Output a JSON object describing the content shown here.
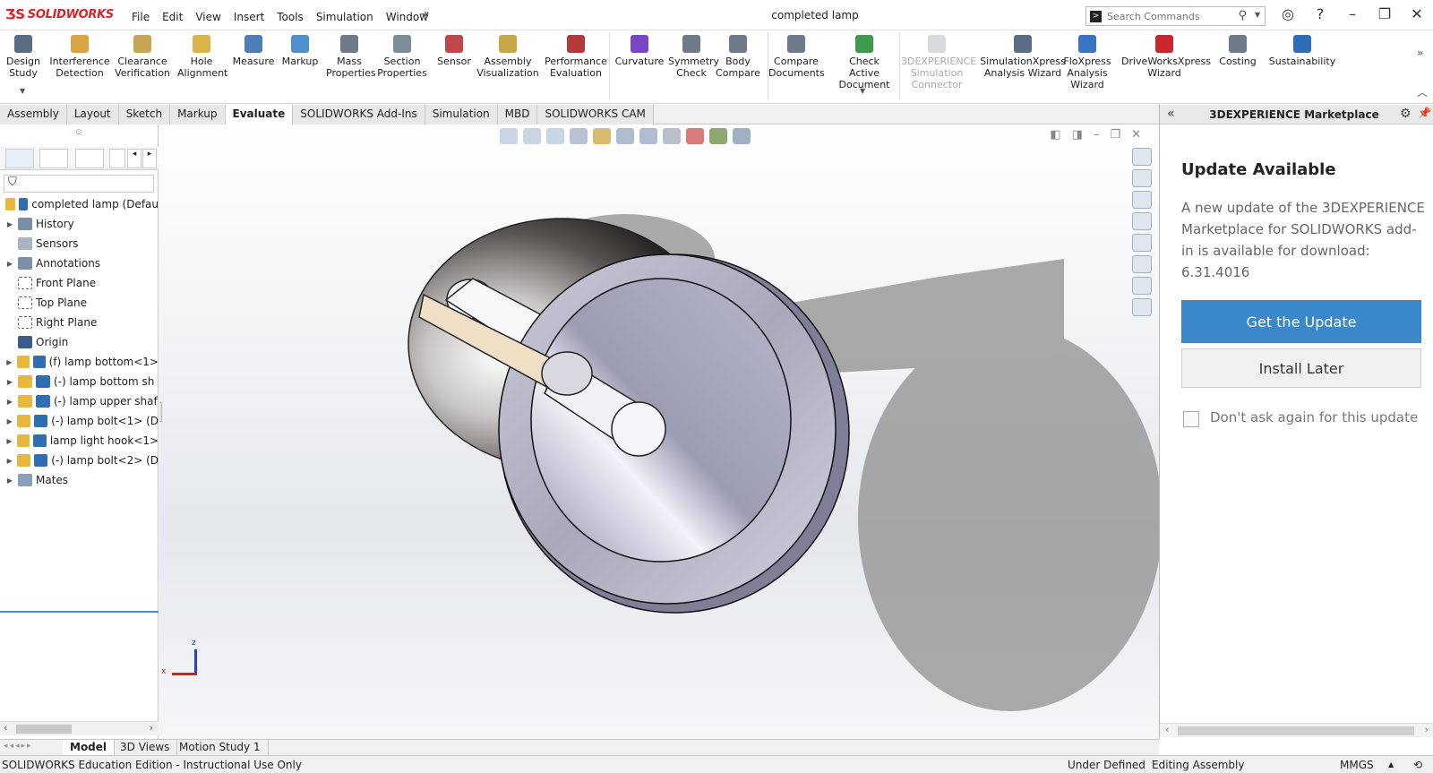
{
  "app": {
    "logo_text": "SOLIDWORKS",
    "document_title": "completed lamp",
    "menu": [
      "File",
      "Edit",
      "View",
      "Insert",
      "Tools",
      "Simulation",
      "Window"
    ],
    "search_placeholder": "Search Commands"
  },
  "ribbon": {
    "buttons": [
      {
        "label": "Design\nStudy",
        "icon": "design-study-icon",
        "color": "#5a6d86"
      },
      {
        "label": "Interference\nDetection",
        "icon": "interference-icon",
        "color": "#d9a441"
      },
      {
        "label": "Clearance\nVerification",
        "icon": "clearance-icon",
        "color": "#c7a653"
      },
      {
        "label": "Hole\nAlignment",
        "icon": "hole-alignment-icon",
        "color": "#d8b44a"
      },
      {
        "label": "Measure",
        "icon": "measure-icon",
        "color": "#4c7fb8"
      },
      {
        "label": "Markup",
        "icon": "markup-icon",
        "color": "#4f8fcf"
      },
      {
        "label": "Mass\nProperties",
        "icon": "mass-properties-icon",
        "color": "#6f7b8a"
      },
      {
        "label": "Section\nProperties",
        "icon": "section-properties-icon",
        "color": "#7e8b99"
      },
      {
        "label": "Sensor",
        "icon": "sensor-icon",
        "color": "#c04848"
      },
      {
        "label": "Assembly\nVisualization",
        "icon": "assembly-visualization-icon",
        "color": "#c9a64a"
      },
      {
        "label": "Performance\nEvaluation",
        "icon": "performance-icon",
        "color": "#b33a3a"
      },
      {
        "label": "Curvature",
        "icon": "curvature-icon",
        "color": "#7a46c4"
      },
      {
        "label": "Symmetry\nCheck",
        "icon": "symmetry-icon",
        "color": "#6f7b8a"
      },
      {
        "label": "Body\nCompare",
        "icon": "body-compare-icon",
        "color": "#6f7b8a"
      },
      {
        "label": "Compare\nDocuments",
        "icon": "compare-documents-icon",
        "color": "#6f7b8a"
      },
      {
        "label": "Check Active\nDocument",
        "icon": "check-active-icon",
        "color": "#3f9a4a"
      },
      {
        "label": "3DEXPERIENCE\nSimulation\nConnector",
        "icon": "3dx-connector-icon",
        "color": "#9aa4ae",
        "disabled": true
      },
      {
        "label": "SimulationXpress\nAnalysis Wizard",
        "icon": "simxpress-icon",
        "color": "#5a6d86"
      },
      {
        "label": "FloXpress\nAnalysis\nWizard",
        "icon": "floxpress-icon",
        "color": "#3a74c4"
      },
      {
        "label": "DriveWorksXpress\nWizard",
        "icon": "driveworks-icon",
        "color": "#c8282e"
      },
      {
        "label": "Costing",
        "icon": "costing-icon",
        "color": "#6f7b8a"
      },
      {
        "label": "Sustainability",
        "icon": "sustainability-icon",
        "color": "#2d6fb7"
      }
    ]
  },
  "tabs": [
    "Assembly",
    "Layout",
    "Sketch",
    "Markup",
    "Evaluate",
    "SOLIDWORKS Add-Ins",
    "Simulation",
    "MBD",
    "SOLIDWORKS CAM"
  ],
  "active_tab": "Evaluate",
  "tree": {
    "root": "completed lamp  (Defau",
    "items": [
      {
        "label": "History",
        "expand": true,
        "icon": "history-icon"
      },
      {
        "label": "Sensors",
        "expand": false,
        "icon": "sensors-icon"
      },
      {
        "label": "Annotations",
        "expand": true,
        "icon": "annotations-icon"
      },
      {
        "label": "Front Plane",
        "expand": false,
        "icon": "plane-icon"
      },
      {
        "label": "Top Plane",
        "expand": false,
        "icon": "plane-icon"
      },
      {
        "label": "Right Plane",
        "expand": false,
        "icon": "plane-icon"
      },
      {
        "label": "Origin",
        "expand": false,
        "icon": "origin-icon"
      },
      {
        "label": "(f) lamp bottom<1>",
        "expand": true,
        "icon": "part-icon"
      },
      {
        "label": "(-) lamp bottom sh",
        "expand": true,
        "icon": "part-icon"
      },
      {
        "label": "(-) lamp upper shaf",
        "expand": true,
        "icon": "part-icon"
      },
      {
        "label": "(-) lamp bolt<1> (D",
        "expand": true,
        "icon": "part-icon"
      },
      {
        "label": "lamp light hook<1>",
        "expand": true,
        "icon": "part-icon"
      },
      {
        "label": "(-) lamp bolt<2> (D",
        "expand": true,
        "icon": "part-icon"
      },
      {
        "label": "Mates",
        "expand": true,
        "icon": "mates-icon"
      }
    ]
  },
  "viewport": {
    "triad": {
      "x": "x",
      "z": "z"
    }
  },
  "pane": {
    "title": "3DEXPERIENCE Marketplace",
    "heading": "Update Available",
    "message": "A new update of the 3DEXPERIENCE Marketplace for SOLIDWORKS add-in is available for download: 6.31.4016",
    "primary_button": "Get the Update",
    "secondary_button": "Install Later",
    "checkbox_label": "Don't ask again for this update"
  },
  "bottom_tabs": [
    "Model",
    "3D Views",
    "Motion Study 1"
  ],
  "status": {
    "edition": "SOLIDWORKS Education Edition - Instructional Use Only",
    "state": "Under Defined",
    "mode": "Editing Assembly",
    "units": "MMGS"
  },
  "colors": {
    "accent": "#3a87c9",
    "brand": "#d8232a"
  }
}
